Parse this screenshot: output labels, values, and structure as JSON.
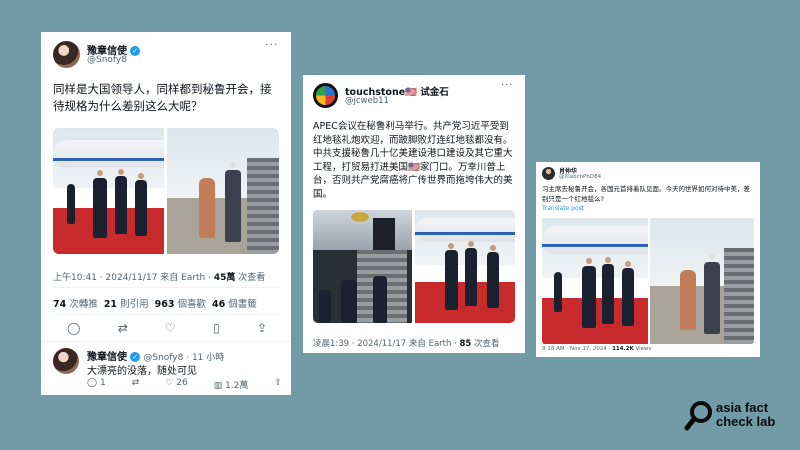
{
  "tweet1": {
    "name": "豫章信使",
    "handle": "@Snofy8",
    "text": "同样是大国领导人，同样都到秘鲁开会，接待规格为什么差别这么大呢？",
    "meta_time": "上午10:41 · 2024/11/17 来自 Earth · ",
    "views_num": "45萬",
    "views_label": " 次查看",
    "stats": [
      {
        "num": "74",
        "label": " 次轉推"
      },
      {
        "num": "21",
        "label": " 則引用"
      },
      {
        "num": "963",
        "label": " 個喜歡"
      },
      {
        "num": "46",
        "label": " 個書籤"
      }
    ],
    "reply": {
      "name": "豫章信使",
      "handle": "@Snofy8 · 11 小時",
      "text": "大漂亮的没落，随处可见",
      "reply_count": "1",
      "like_count": "26",
      "view_count": "1.2萬"
    }
  },
  "tweet2": {
    "name": "touchstone🇺🇸 试金石",
    "handle": "@jcweb11",
    "text": "APEC会议在秘鲁利马举行。共产党习近平受到红地毯礼炮欢迎，而跛脚败灯连红地毯都没有。中共支援秘鲁几十亿美建设港口建设及其它重大工程，打贸易打进美国🇺🇸家门口。万幸川普上台，否则共产党腐癌将广传世界而拖垮伟大的美国。",
    "meta_time": "凌晨1:39 · 2024/11/17 来自 Earth · ",
    "views_num": "85",
    "views_label": " 次查看"
  },
  "tweet3": {
    "name": "肖仲华",
    "handle": "@XiaochPhD84",
    "text": "习主席去秘鲁开会，各国元首排着队见面。今天的世界如何对待中美，差别只是一个红地毯么?",
    "translate": "Translate post",
    "meta_time": "9:18 AM · Nov 17, 2024 · ",
    "views_num": "114.2K",
    "views_label": " Views"
  },
  "brand": {
    "line1": "asia fact",
    "line2": "check lab"
  },
  "colors": {
    "background": "#719ba6",
    "verified": "#1d9bf0",
    "carpet": "#c92b2d"
  }
}
